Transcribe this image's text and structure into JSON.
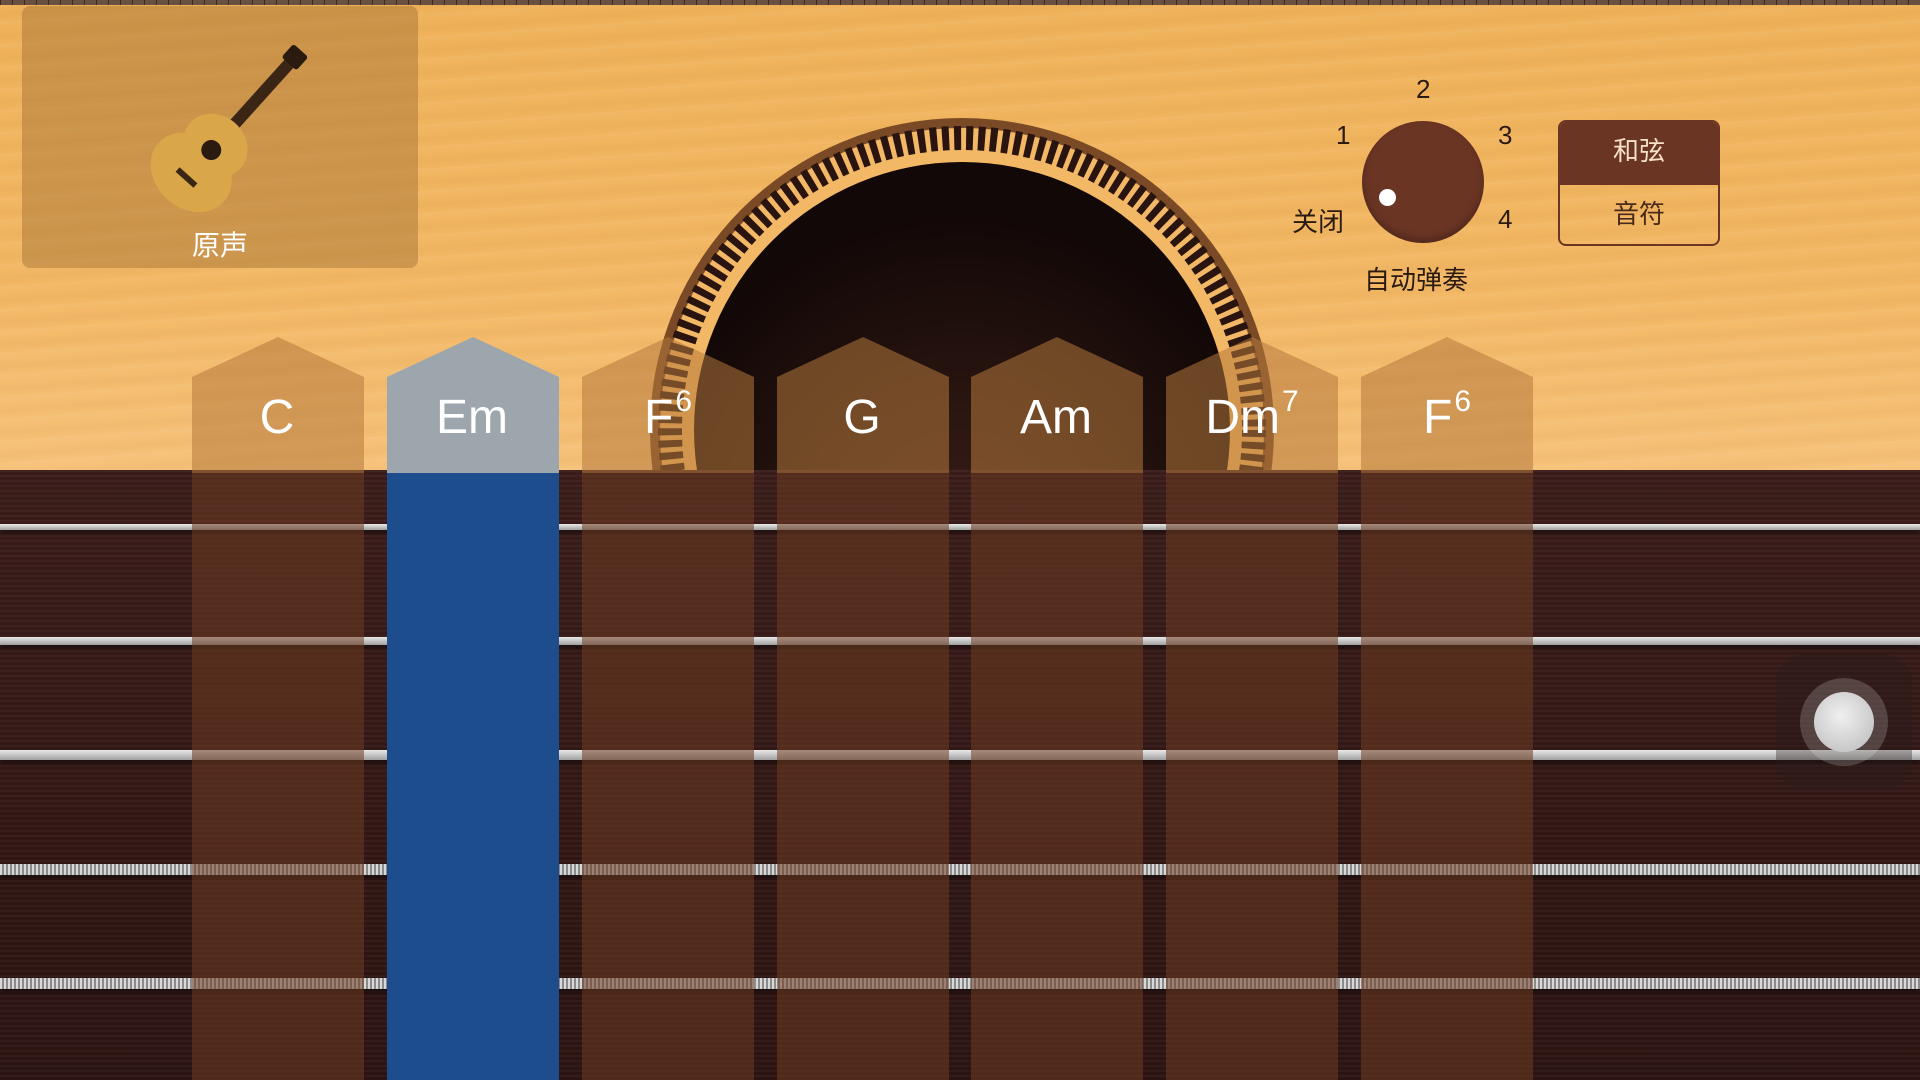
{
  "instrument": {
    "name": "原声",
    "icon": "acoustic-guitar-icon"
  },
  "autoplay": {
    "label": "自动弹奏",
    "off_label": "关闭",
    "positions": [
      "1",
      "2",
      "3",
      "4"
    ],
    "selected": "关闭"
  },
  "mode_toggle": {
    "chords_label": "和弦",
    "notes_label": "音符",
    "selected": "和弦"
  },
  "chords": [
    {
      "name": "C",
      "sup": "",
      "selected": false
    },
    {
      "name": "Em",
      "sup": "",
      "selected": true
    },
    {
      "name": "F",
      "sup": "6",
      "selected": false
    },
    {
      "name": "G",
      "sup": "",
      "selected": false
    },
    {
      "name": "Am",
      "sup": "",
      "selected": false
    },
    {
      "name": "Dm",
      "sup": "7",
      "selected": false
    },
    {
      "name": "F",
      "sup": "6",
      "selected": false
    }
  ],
  "colors": {
    "wood": "#f3b865",
    "fretboard": "#2c1412",
    "knob": "#6b3524",
    "selected_chord": "#1e4d8e"
  }
}
